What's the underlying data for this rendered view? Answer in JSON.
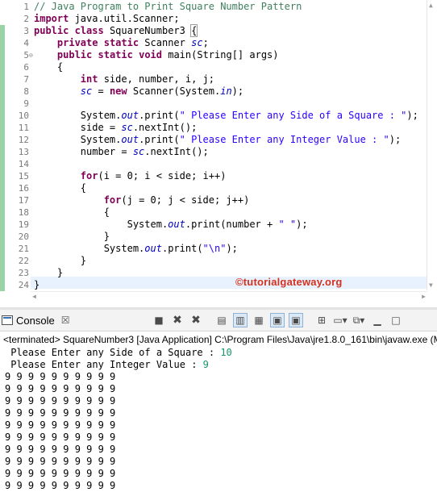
{
  "editor": {
    "line_numbers": [
      "1",
      "2",
      "3",
      "4",
      "5",
      "6",
      "7",
      "8",
      "9",
      "10",
      "11",
      "12",
      "13",
      "14",
      "15",
      "16",
      "17",
      "18",
      "19",
      "20",
      "21",
      "22",
      "23",
      "24"
    ],
    "lines": [
      [
        {
          "t": "// Java Program to Print Square Number Pattern",
          "c": "cm"
        }
      ],
      [
        {
          "t": "import",
          "c": "kw"
        },
        {
          "t": " java.util.Scanner;",
          "c": "vr"
        }
      ],
      [
        {
          "t": "public",
          "c": "kw"
        },
        {
          "t": " ",
          "c": "vr"
        },
        {
          "t": "class",
          "c": "kw"
        },
        {
          "t": " SquareNumber3 ",
          "c": "vr"
        },
        {
          "t": "{",
          "c": "vr",
          "box": true
        }
      ],
      [
        {
          "t": "    ",
          "c": "vr"
        },
        {
          "t": "private",
          "c": "kw"
        },
        {
          "t": " ",
          "c": "vr"
        },
        {
          "t": "static",
          "c": "kw"
        },
        {
          "t": " Scanner ",
          "c": "vr"
        },
        {
          "t": "sc",
          "c": "fi"
        },
        {
          "t": ";",
          "c": "vr"
        }
      ],
      [
        {
          "t": "    ",
          "c": "vr"
        },
        {
          "t": "public",
          "c": "kw"
        },
        {
          "t": " ",
          "c": "vr"
        },
        {
          "t": "static",
          "c": "kw"
        },
        {
          "t": " ",
          "c": "vr"
        },
        {
          "t": "void",
          "c": "kw"
        },
        {
          "t": " main(String[] args)",
          "c": "vr"
        }
      ],
      [
        {
          "t": "    {",
          "c": "vr"
        }
      ],
      [
        {
          "t": "        ",
          "c": "vr"
        },
        {
          "t": "int",
          "c": "kw"
        },
        {
          "t": " side, number, i, j;",
          "c": "vr"
        }
      ],
      [
        {
          "t": "        ",
          "c": "vr"
        },
        {
          "t": "sc",
          "c": "fi"
        },
        {
          "t": " = ",
          "c": "vr"
        },
        {
          "t": "new",
          "c": "kw"
        },
        {
          "t": " Scanner(System.",
          "c": "vr"
        },
        {
          "t": "in",
          "c": "fi"
        },
        {
          "t": ");",
          "c": "vr"
        }
      ],
      [],
      [
        {
          "t": "        System.",
          "c": "vr"
        },
        {
          "t": "out",
          "c": "fi"
        },
        {
          "t": ".print(",
          "c": "vr"
        },
        {
          "t": "\" Please Enter any Side of a Square : \"",
          "c": "st"
        },
        {
          "t": ");",
          "c": "vr"
        }
      ],
      [
        {
          "t": "        side = ",
          "c": "vr"
        },
        {
          "t": "sc",
          "c": "fi"
        },
        {
          "t": ".nextInt();",
          "c": "vr"
        }
      ],
      [
        {
          "t": "        System.",
          "c": "vr"
        },
        {
          "t": "out",
          "c": "fi"
        },
        {
          "t": ".print(",
          "c": "vr"
        },
        {
          "t": "\" Please Enter any Integer Value : \"",
          "c": "st"
        },
        {
          "t": ");",
          "c": "vr"
        }
      ],
      [
        {
          "t": "        number = ",
          "c": "vr"
        },
        {
          "t": "sc",
          "c": "fi"
        },
        {
          "t": ".nextInt();",
          "c": "vr"
        }
      ],
      [],
      [
        {
          "t": "        ",
          "c": "vr"
        },
        {
          "t": "for",
          "c": "kw"
        },
        {
          "t": "(i = 0; i < side; i++)",
          "c": "vr"
        }
      ],
      [
        {
          "t": "        {",
          "c": "vr"
        }
      ],
      [
        {
          "t": "            ",
          "c": "vr"
        },
        {
          "t": "for",
          "c": "kw"
        },
        {
          "t": "(j = 0; j < side; j++)",
          "c": "vr"
        }
      ],
      [
        {
          "t": "            {",
          "c": "vr"
        }
      ],
      [
        {
          "t": "                System.",
          "c": "vr"
        },
        {
          "t": "out",
          "c": "fi"
        },
        {
          "t": ".print(number + ",
          "c": "vr"
        },
        {
          "t": "\" \"",
          "c": "st"
        },
        {
          "t": ");",
          "c": "vr"
        }
      ],
      [
        {
          "t": "            }",
          "c": "vr"
        }
      ],
      [
        {
          "t": "            System.",
          "c": "vr"
        },
        {
          "t": "out",
          "c": "fi"
        },
        {
          "t": ".print(",
          "c": "vr"
        },
        {
          "t": "\"\\n\"",
          "c": "st"
        },
        {
          "t": ");",
          "c": "vr"
        }
      ],
      [
        {
          "t": "        }",
          "c": "vr"
        }
      ],
      [
        {
          "t": "    }",
          "c": "vr"
        }
      ],
      [
        {
          "t": "}",
          "c": "vr"
        }
      ]
    ],
    "fold_marker": "⊖",
    "watermark": "©tutorialgateway.org"
  },
  "console": {
    "tab_label": "Console",
    "tab_close": "☒",
    "toolbar_icons": [
      "terminate-icon",
      "remove-launch-icon",
      "remove-all-icon",
      "scroll-lock-icon",
      "word-wrap-icon",
      "show-stdout-icon",
      "show-stderr-icon",
      "pin-console-icon",
      "display-console-icon",
      "open-console-icon",
      "minimize-icon",
      "maximize-icon"
    ],
    "terminated_label": "<terminated> SquareNumber3 [Java Application] C:\\Program Files\\Java\\jre1.8.0_161\\bin\\javaw.exe (M",
    "prompt1": " Please Enter any Side of a Square : ",
    "input1": "10",
    "prompt2": " Please Enter any Integer Value : ",
    "input2": "9",
    "rows": [
      "9 9 9 9 9 9 9 9 9 9 ",
      "9 9 9 9 9 9 9 9 9 9 ",
      "9 9 9 9 9 9 9 9 9 9 ",
      "9 9 9 9 9 9 9 9 9 9 ",
      "9 9 9 9 9 9 9 9 9 9 ",
      "9 9 9 9 9 9 9 9 9 9 ",
      "9 9 9 9 9 9 9 9 9 9 ",
      "9 9 9 9 9 9 9 9 9 9 ",
      "9 9 9 9 9 9 9 9 9 9 ",
      "9 9 9 9 9 9 9 9 9 9 "
    ]
  }
}
